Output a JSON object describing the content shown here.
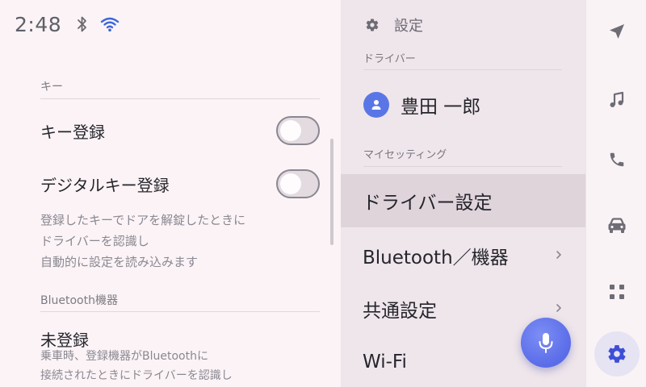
{
  "status_bar": {
    "time": "2:48"
  },
  "key_section": {
    "header": "キー",
    "key_registration_label": "キー登録",
    "key_registration_enabled": false,
    "digital_key_label": "デジタルキー登録",
    "digital_key_enabled": false,
    "description_lines": [
      "登録したキーでドアを解錠したときに",
      "ドライバーを認識し",
      "自動的に設定を読み込みます"
    ]
  },
  "bluetooth_section": {
    "header": "Bluetooth機器",
    "status": "未登録",
    "description_lines": [
      "乗車時、登録機器がBluetoothに",
      "接続されたときにドライバーを認識し"
    ]
  },
  "settings_menu": {
    "title": "設定",
    "driver_header": "ドライバー",
    "driver_name": "豊田 一郎",
    "my_settings_header": "マイセッティング",
    "items": [
      {
        "label": "ドライバー設定",
        "selected": true
      },
      {
        "label": "Bluetooth／機器",
        "selected": false
      },
      {
        "label": "共通設定",
        "selected": false
      },
      {
        "label": "Wi-Fi",
        "selected": false
      }
    ]
  },
  "nav_rail": {
    "items": [
      {
        "icon": "navigation-arrow-icon",
        "active": false
      },
      {
        "icon": "music-note-icon",
        "active": false
      },
      {
        "icon": "phone-icon",
        "active": false
      },
      {
        "icon": "car-icon",
        "active": false
      },
      {
        "icon": "apps-grid-icon",
        "active": false
      },
      {
        "icon": "gear-icon",
        "active": true
      }
    ]
  },
  "colors": {
    "accent": "#5a6ce8",
    "active_gear": "#3d4fd6",
    "selected_row": "#e0d4db",
    "icon_gray": "#6e6c75"
  }
}
